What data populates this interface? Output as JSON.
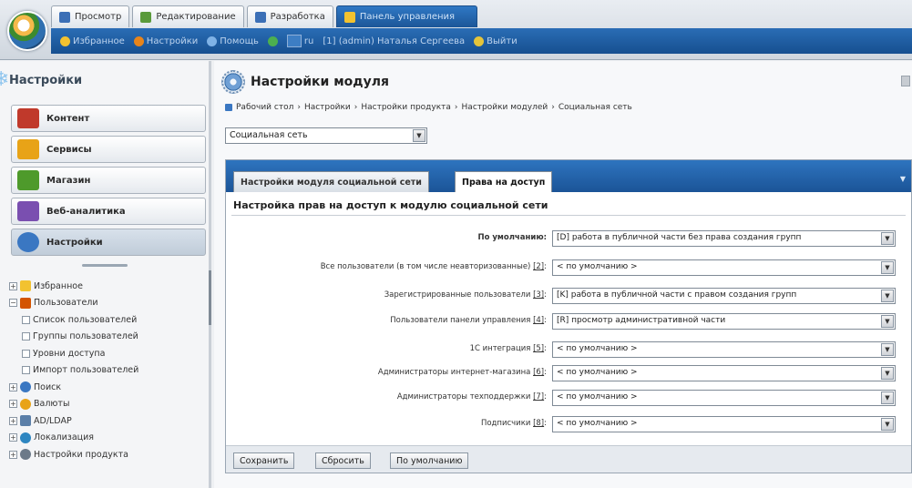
{
  "top": {
    "tabs": [
      {
        "label": "Просмотр"
      },
      {
        "label": "Редактирование"
      },
      {
        "label": "Разработка"
      },
      {
        "label": "Панель управления"
      }
    ],
    "subbar": [
      {
        "label": "Избранное"
      },
      {
        "label": "Настройки"
      },
      {
        "label": "Помощь"
      },
      {
        "label": "ru"
      },
      {
        "label": "[1] (admin) Наталья Сергеева"
      },
      {
        "label": "Выйти"
      }
    ]
  },
  "left": {
    "title": "Настройки",
    "buttons": [
      {
        "label": "Контент",
        "color": "#c0392b"
      },
      {
        "label": "Сервисы",
        "color": "#e8a317"
      },
      {
        "label": "Магазин",
        "color": "#4e9a2b"
      },
      {
        "label": "Веб-аналитика",
        "color": "#7a4fb0"
      },
      {
        "label": "Настройки",
        "color": "#3a77c2"
      }
    ],
    "tree": [
      {
        "label": "Избранное",
        "level": 1,
        "pm": "+",
        "color": "#f2c230"
      },
      {
        "label": "Пользователи",
        "level": 1,
        "pm": "−",
        "color": "#d35400"
      },
      {
        "label": "Список пользователей",
        "level": 2,
        "pm": "",
        "color": ""
      },
      {
        "label": "Группы пользователей",
        "level": 2,
        "pm": "",
        "color": ""
      },
      {
        "label": "Уровни доступа",
        "level": 2,
        "pm": "",
        "color": ""
      },
      {
        "label": "Импорт пользователей",
        "level": 2,
        "pm": "",
        "color": ""
      },
      {
        "label": "Поиск",
        "level": 1,
        "pm": "+",
        "color": "#3a77c2"
      },
      {
        "label": "Валюты",
        "level": 1,
        "pm": "+",
        "color": "#e8a317"
      },
      {
        "label": "AD/LDAP",
        "level": 1,
        "pm": "+",
        "color": "#5b7fa8"
      },
      {
        "label": "Локализация",
        "level": 1,
        "pm": "+",
        "color": "#2e86c1"
      },
      {
        "label": "Настройки продукта",
        "level": 1,
        "pm": "+",
        "color": "#6c7a89"
      }
    ]
  },
  "main": {
    "title": "Настройки модуля",
    "breadcrumb": [
      "Рабочий стол",
      "›",
      "Настройки",
      "›",
      "Настройки продукта",
      "›",
      "Настройки модулей",
      "›",
      "Социальная сеть"
    ],
    "module_select": "Социальная сеть",
    "tabs": [
      {
        "label": "Настройки модуля социальной сети"
      },
      {
        "label": "Права на доступ"
      }
    ],
    "section_title": "Настройка прав на доступ к модулю социальной сети",
    "rows": [
      {
        "label": "По умолчанию:",
        "num": "",
        "value": "[D] работа в публичной части без права создания групп"
      },
      {
        "label": "Все пользователи (в том числе неавторизованные) ",
        "num": "[2]",
        "value": "< по умолчанию >"
      },
      {
        "label": "Зарегистрированные пользователи ",
        "num": "[3]",
        "value": "[K] работа в публичной части с правом создания групп"
      },
      {
        "label": "Пользователи панели управления ",
        "num": "[4]",
        "value": "[R] просмотр административной части"
      },
      {
        "label": "1С интеграция ",
        "num": "[5]",
        "value": "< по умолчанию >"
      },
      {
        "label": "Администраторы интернет-магазина ",
        "num": "[6]",
        "value": "< по умолчанию >"
      },
      {
        "label": "Администраторы техподдержки ",
        "num": "[7]",
        "value": "< по умолчанию >"
      },
      {
        "label": "Подписчики ",
        "num": "[8]",
        "value": "< по умолчанию >"
      }
    ],
    "buttons": {
      "save": "Сохранить",
      "reset": "Сбросить",
      "default": "По умолчанию"
    }
  }
}
